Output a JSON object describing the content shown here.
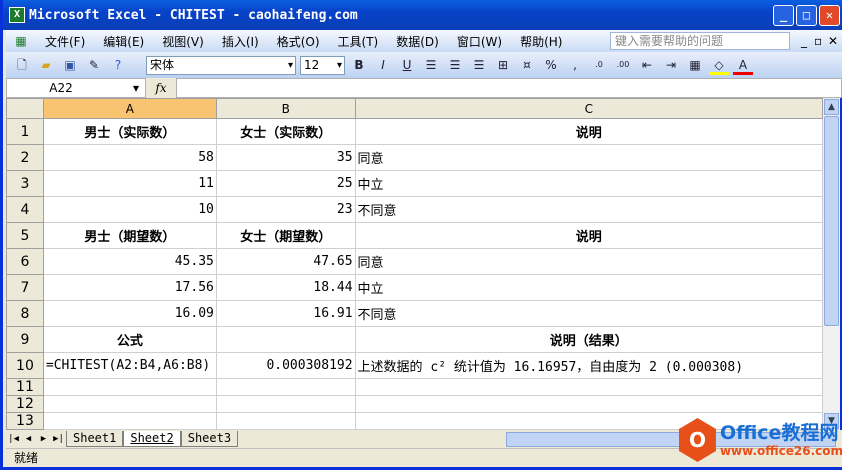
{
  "window": {
    "title": "Microsoft Excel - CHITEST - caohaifeng.com"
  },
  "menu": [
    "文件(F)",
    "编辑(E)",
    "视图(V)",
    "插入(I)",
    "格式(O)",
    "工具(T)",
    "数据(D)",
    "窗口(W)",
    "帮助(H)"
  ],
  "help_placeholder": "键入需要帮助的问题",
  "toolbar": {
    "font": "宋体",
    "size": "12",
    "bold": "B",
    "italic": "I",
    "underline": "U",
    "percent": "%",
    "comma": ","
  },
  "formula_bar": {
    "name_box": "A22",
    "fx": "fx",
    "formula": ""
  },
  "columns": [
    "A",
    "B",
    "C"
  ],
  "rows": [
    {
      "n": "1",
      "a": "男士（实际数）",
      "b": "女士（实际数）",
      "c": "说明",
      "header": true
    },
    {
      "n": "2",
      "a": "58",
      "b": "35",
      "c": "同意"
    },
    {
      "n": "3",
      "a": "11",
      "b": "25",
      "c": "中立"
    },
    {
      "n": "4",
      "a": "10",
      "b": "23",
      "c": "不同意"
    },
    {
      "n": "5",
      "a": "男士（期望数）",
      "b": "女士（期望数）",
      "c": "说明",
      "header": true
    },
    {
      "n": "6",
      "a": "45.35",
      "b": "47.65",
      "c": "同意"
    },
    {
      "n": "7",
      "a": "17.56",
      "b": "18.44",
      "c": "中立"
    },
    {
      "n": "8",
      "a": "16.09",
      "b": "16.91",
      "c": "不同意"
    },
    {
      "n": "9",
      "a": "公式",
      "b": "",
      "c": "说明（结果）",
      "header": true
    },
    {
      "n": "10",
      "a": "=CHITEST(A2:B4,A6:B8)",
      "b": "0.000308192",
      "c": "上述数据的 c² 统计值为 16.16957，自由度为 2 (0.000308)",
      "formula": true
    },
    {
      "n": "11",
      "a": "",
      "b": "",
      "c": "",
      "small": true
    },
    {
      "n": "12",
      "a": "",
      "b": "",
      "c": "",
      "small": true
    },
    {
      "n": "13",
      "a": "",
      "b": "",
      "c": "",
      "small": true
    }
  ],
  "sheets": [
    "Sheet1",
    "Sheet2",
    "Sheet3"
  ],
  "active_sheet": "Sheet2",
  "status": "就绪",
  "watermark": {
    "line1": "Office教程网",
    "line2": "www.office26.com"
  }
}
